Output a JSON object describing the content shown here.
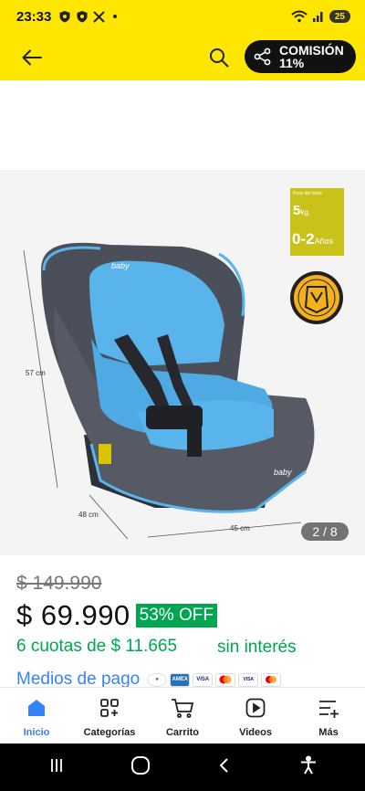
{
  "status_bar": {
    "time": "23:33",
    "battery": "25",
    "icons": [
      "shield-icon",
      "shield-icon",
      "x-logo-icon",
      "notification-dot",
      "wifi-icon",
      "signal-icon",
      "battery-icon"
    ]
  },
  "header": {
    "back_icon": "arrow-left-icon",
    "search_icon": "search-icon",
    "commission_icon": "share-icon",
    "commission_label": "COMISIÓN",
    "commission_value": "11%",
    "background": "#ffe600"
  },
  "gallery": {
    "counter": "2 / 8",
    "badge_top": "Peso del bebé",
    "badge_weight": "5",
    "badge_weight_unit": "kg.",
    "badge_age": "0-2",
    "badge_age_unit": "Años",
    "brand": "baby way",
    "dimensions": {
      "height": "57 cm",
      "depth": "48 cm",
      "width": "45 cm"
    }
  },
  "product": {
    "old_price": "$ 149.990",
    "price": "$ 69.990",
    "discount": "53% OFF",
    "installments": "6 cuotas de $ 11.665",
    "installments_note": "sin interés",
    "payment_link": "Medios de pago",
    "payment_icons": [
      "Mercado Pago",
      "AMEX",
      "VISA",
      "Mastercard",
      "VISA",
      "Mastercard"
    ]
  },
  "bottom_nav": [
    {
      "label": "Inicio",
      "icon": "home-icon",
      "active": true
    },
    {
      "label": "Categorías",
      "icon": "grid-plus-icon",
      "active": false
    },
    {
      "label": "Carrito",
      "icon": "cart-icon",
      "active": false
    },
    {
      "label": "Videos",
      "icon": "play-icon",
      "active": false
    },
    {
      "label": "Más",
      "icon": "menu-plus-icon",
      "active": false
    }
  ],
  "colors": {
    "accent_yellow": "#ffe600",
    "green": "#00a650",
    "link_blue": "#3483fa",
    "seat_blue": "#5ab4ec",
    "seat_gray": "#4a4e58"
  }
}
